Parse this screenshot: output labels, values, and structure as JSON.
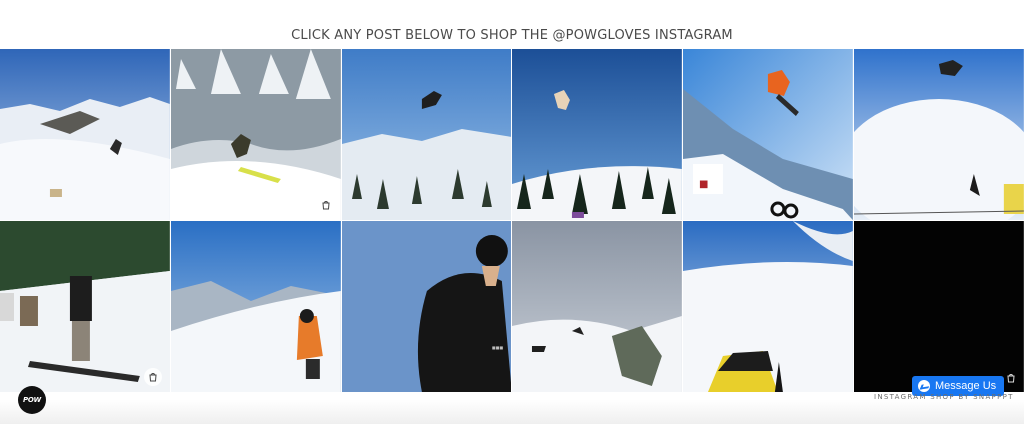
{
  "heading": "CLICK ANY POST BELOW TO SHOP THE @POWGLOVES INSTAGRAM",
  "posts": [
    {
      "alt": "Skier carving down a snowy ridge under blue sky"
    },
    {
      "alt": "Skier spraying powder among snow-covered trees"
    },
    {
      "alt": "Skier mid-air inverted over snowy forest"
    },
    {
      "alt": "Snowboarder airborne above tree line"
    },
    {
      "alt": "Snowboarder grabbing board over a kicker"
    },
    {
      "alt": "Rider flipping above a park jump"
    },
    {
      "alt": "Group of snowboarders hanging out on a slope"
    },
    {
      "alt": "Rider in orange jacket on a mountain ridge"
    },
    {
      "alt": "Person in black hoodie against blue sky"
    },
    {
      "alt": "Rider hiking up a snowy ridge"
    },
    {
      "alt": "First-person view from a snowmobile"
    },
    {
      "alt": "Dark night post"
    }
  ],
  "logo_text": "POW",
  "messenger_label": "Message Us",
  "footer_credit": "INSTAGRAM SHOP BY SNAPPPT",
  "colors": {
    "messenger": "#1877f2",
    "heading": "#4a4a4a"
  }
}
